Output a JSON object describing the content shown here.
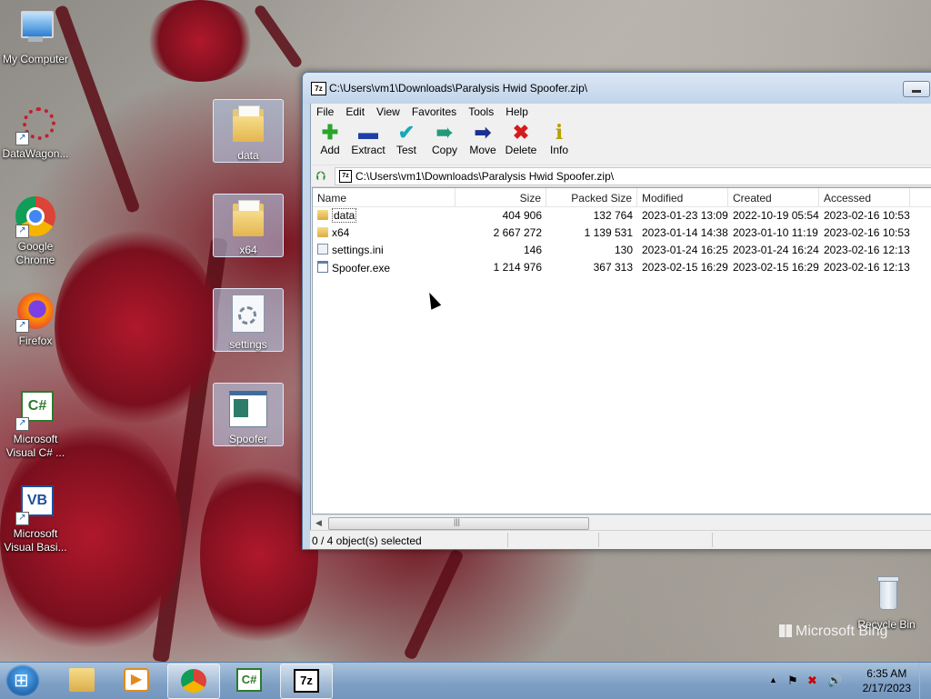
{
  "desktop": {
    "icons": [
      {
        "label": "My Computer"
      },
      {
        "label": "DataWagon..."
      },
      {
        "label": "Google Chrome"
      },
      {
        "label": "Firefox"
      },
      {
        "label": "Microsoft Visual C# ..."
      },
      {
        "label": "Microsoft Visual Basi..."
      }
    ],
    "selected_icons": [
      {
        "label": "data"
      },
      {
        "label": "x64"
      },
      {
        "label": "settings"
      },
      {
        "label": "Spoofer"
      }
    ],
    "recycle_bin": "Recycle Bin",
    "watermark": "Microsoft Bing"
  },
  "window": {
    "app_icon": "7z",
    "title": "C:\\Users\\vm1\\Downloads\\Paralysis Hwid Spoofer.zip\\",
    "menu": [
      "File",
      "Edit",
      "View",
      "Favorites",
      "Tools",
      "Help"
    ],
    "toolbar": [
      {
        "label": "Add",
        "icon": "plus-icon",
        "color": "#2aa52a"
      },
      {
        "label": "Extract",
        "icon": "minus-icon",
        "color": "#1d3fa8"
      },
      {
        "label": "Test",
        "icon": "check-icon",
        "color": "#18a9b8"
      },
      {
        "label": "Copy",
        "icon": "double-arrow-icon",
        "color": "#1e9a7a"
      },
      {
        "label": "Move",
        "icon": "arrow-right-icon",
        "color": "#1d2f8f"
      },
      {
        "label": "Delete",
        "icon": "x-icon",
        "color": "#d41c1c"
      },
      {
        "label": "Info",
        "icon": "info-icon",
        "color": "#b8a000"
      }
    ],
    "address": "C:\\Users\\vm1\\Downloads\\Paralysis Hwid Spoofer.zip\\",
    "columns": [
      "Name",
      "Size",
      "Packed Size",
      "Modified",
      "Created",
      "Accessed"
    ],
    "rows": [
      {
        "name": "data",
        "type": "folder",
        "size": "404 906",
        "packed": "132 764",
        "modified": "2023-01-23 13:09",
        "created": "2022-10-19 05:54",
        "accessed": "2023-02-16 10:53"
      },
      {
        "name": "x64",
        "type": "folder",
        "size": "2 667 272",
        "packed": "1 139 531",
        "modified": "2023-01-14 14:38",
        "created": "2023-01-10 11:19",
        "accessed": "2023-02-16 10:53"
      },
      {
        "name": "settings.ini",
        "type": "ini",
        "size": "146",
        "packed": "130",
        "modified": "2023-01-24 16:25",
        "created": "2023-01-24 16:24",
        "accessed": "2023-02-16 12:13"
      },
      {
        "name": "Spoofer.exe",
        "type": "exe",
        "size": "1 214 976",
        "packed": "367 313",
        "modified": "2023-02-15 16:29",
        "created": "2023-02-15 16:29",
        "accessed": "2023-02-16 12:13"
      }
    ],
    "status": "0 / 4 object(s) selected"
  },
  "taskbar": {
    "time": "6:35 AM",
    "date": "2/17/2023"
  }
}
